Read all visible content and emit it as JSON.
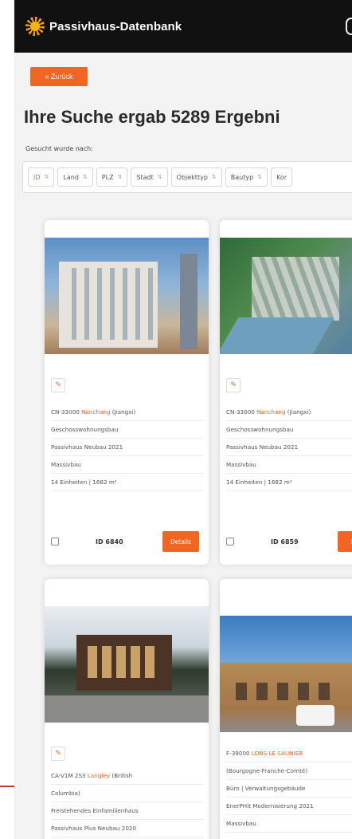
{
  "app": {
    "title": "Passivhaus-Datenbank"
  },
  "nav": {
    "back_label": "« Zurück"
  },
  "results": {
    "title": "Ihre Suche ergab 5289 Ergebni",
    "searched_label": "Gesucht wurde nach:"
  },
  "filters": [
    {
      "label": "ID"
    },
    {
      "label": "Land"
    },
    {
      "label": "PLZ"
    },
    {
      "label": "Stadt"
    },
    {
      "label": "Objekttyp"
    },
    {
      "label": "Bautyp"
    },
    {
      "label": "Kor"
    }
  ],
  "cards": [
    {
      "location_prefix": "CN-33000 ",
      "city": "Nanchang",
      "location_suffix": " (Jiangxi)",
      "lines": [
        "Geschosswohnungsbau",
        "Passivhaus Neubau 2021",
        "Massivbau",
        "14 Einheiten | 1682 m²"
      ],
      "id_label": "ID 6840",
      "details_label": "Details"
    },
    {
      "location_prefix": "CN-33000 ",
      "city": "Nanchang",
      "location_suffix": " (Jiangxi)",
      "lines": [
        "Geschosswohnungsbau",
        "Passivhaus Neubau 2021",
        "Massivbau",
        "14 Einheiten | 1682 m²"
      ],
      "id_label": "ID 6859",
      "details_label": "Det"
    },
    {
      "location_prefix": "CA-V1M 2S3 ",
      "city": "Langley",
      "location_suffix": " (British",
      "lines": [
        "Columbia)",
        "Freistehendes Einfamilienhaus",
        "Passivhaus Plus Neubau 2020"
      ],
      "id_label": "",
      "details_label": ""
    },
    {
      "location_prefix": "F-39000 ",
      "city": "LONS LE SAUNIER",
      "location_suffix": "",
      "lines": [
        "(Bourgogne-Franche-Comté)",
        "Büro | Verwaltungsgebäude",
        "EnerPHit Modernisierung 2021",
        "Massivbau"
      ],
      "id_label": "",
      "details_label": ""
    }
  ],
  "colors": {
    "accent": "#f26522",
    "topbar": "#111111",
    "background": "#f3f3f3"
  }
}
